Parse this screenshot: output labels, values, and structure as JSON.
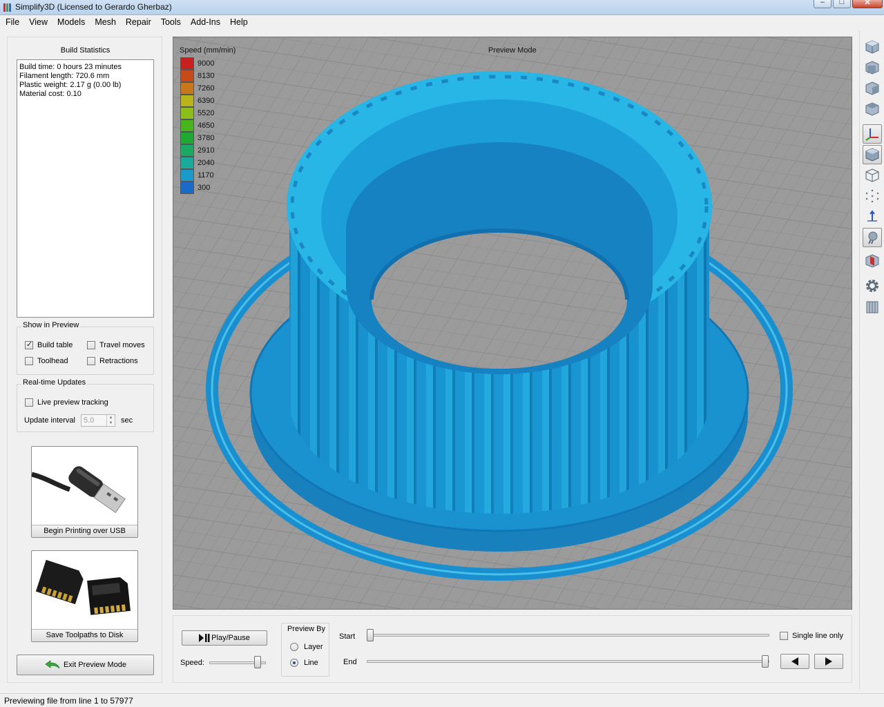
{
  "window": {
    "title": "Simplify3D (Licensed to Gerardo Gherbaz)"
  },
  "menu": [
    "File",
    "View",
    "Models",
    "Mesh",
    "Repair",
    "Tools",
    "Add-Ins",
    "Help"
  ],
  "build_stats": {
    "title": "Build Statistics",
    "lines": [
      "Build time: 0 hours 23 minutes",
      "Filament length: 720.6 mm",
      "Plastic weight: 2.17 g (0.00 lb)",
      "Material cost: 0.10"
    ]
  },
  "show_in_preview": {
    "title": "Show in Preview",
    "build_table": {
      "label": "Build table",
      "checked": true
    },
    "travel_moves": {
      "label": "Travel moves",
      "checked": false
    },
    "toolhead": {
      "label": "Toolhead",
      "checked": false
    },
    "retractions": {
      "label": "Retractions",
      "checked": false
    }
  },
  "realtime": {
    "title": "Real-time Updates",
    "live_tracking": {
      "label": "Live preview tracking",
      "checked": false
    },
    "interval_label": "Update interval",
    "interval_value": "5.0",
    "interval_unit": "sec"
  },
  "actions": {
    "usb_label": "Begin Printing over USB",
    "disk_label": "Save Toolpaths to Disk",
    "exit_label": "Exit Preview Mode"
  },
  "viewport": {
    "mode_label": "Preview Mode",
    "legend_title": "Speed (mm/min)",
    "legend": [
      {
        "value": "9000",
        "color": "#c8201e"
      },
      {
        "value": "8130",
        "color": "#c84a1a"
      },
      {
        "value": "7260",
        "color": "#c8781a"
      },
      {
        "value": "6390",
        "color": "#b8b41a"
      },
      {
        "value": "5520",
        "color": "#8cbe1a"
      },
      {
        "value": "4650",
        "color": "#4ab41e"
      },
      {
        "value": "3780",
        "color": "#1eaa32"
      },
      {
        "value": "2910",
        "color": "#1aaa64"
      },
      {
        "value": "2040",
        "color": "#1aaa9a"
      },
      {
        "value": "1170",
        "color": "#1a9ac8"
      },
      {
        "value": "300",
        "color": "#1a6ac8"
      }
    ],
    "model_color": "#1a9ad6",
    "model_highlight": "#2fc6e6"
  },
  "controls": {
    "play_label": "Play/Pause",
    "speed_label": "Speed:",
    "preview_by_title": "Preview By",
    "layer_label": "Layer",
    "line_label": "Line",
    "preview_by_selected": "Line",
    "start_label": "Start",
    "end_label": "End",
    "single_line_label": "Single line only",
    "single_line_checked": false
  },
  "status": {
    "text": "Previewing file from line 1 to 57977"
  }
}
